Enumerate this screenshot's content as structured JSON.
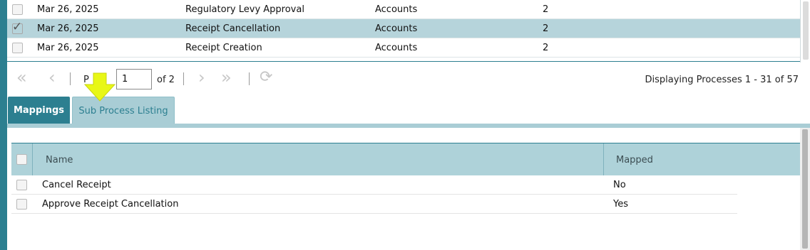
{
  "processes": {
    "rows": [
      {
        "date": "Mar 26, 2025",
        "name": "Regulatory Levy Approval",
        "department": "Accounts",
        "count": "2",
        "checked": false
      },
      {
        "date": "Mar 26, 2025",
        "name": "Receipt Cancellation",
        "department": "Accounts",
        "count": "2",
        "checked": true
      },
      {
        "date": "Mar 26, 2025",
        "name": "Receipt Creation",
        "department": "Accounts",
        "count": "2",
        "checked": false
      }
    ]
  },
  "pager": {
    "first_icon": "double-chevron-left-icon",
    "prev_icon": "chevron-left-icon",
    "next_icon": "chevron-right-icon",
    "last_icon": "double-chevron-right-icon",
    "refresh_icon": "refresh-icon",
    "page_label": "P",
    "page_value": "1",
    "of_text": "of 2",
    "display_text": "Displaying Processes 1 - 31 of 57"
  },
  "tabs": [
    {
      "label": "Mappings",
      "active": true
    },
    {
      "label": "Sub Process Listing",
      "active": false
    }
  ],
  "annotation": {
    "icon": "yellow-arrow-down-icon",
    "color": "#e8f716"
  },
  "sub_grid": {
    "columns": {
      "name": "Name",
      "mapped": "Mapped"
    },
    "rows": [
      {
        "name": "Cancel Receipt",
        "mapped": "No"
      },
      {
        "name": "Approve Receipt Cancellation",
        "mapped": "Yes"
      }
    ]
  },
  "colors": {
    "accent": "#2c7f90",
    "selected_row": "#b6d4db",
    "header_bg": "#aed2d9"
  }
}
